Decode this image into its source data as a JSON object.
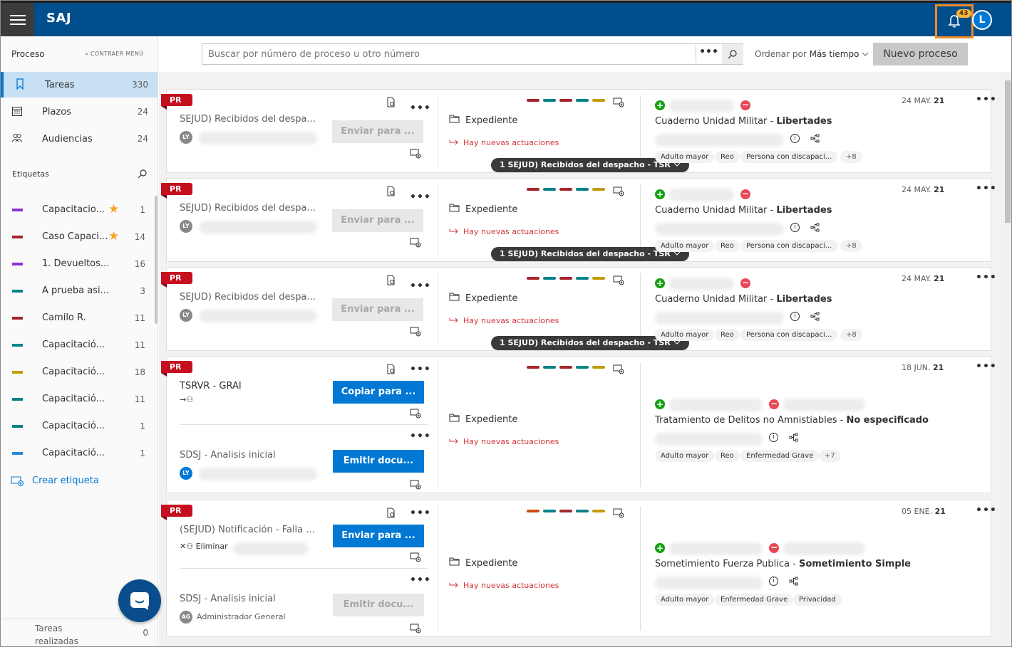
{
  "app": {
    "brand": "SAJ",
    "notifications": "43",
    "user_initial": "L"
  },
  "sidebar": {
    "header": "Proceso",
    "collapse": "« CONTRAER MENÚ",
    "nav": [
      {
        "label": "Tareas",
        "count": "330",
        "icon": "bookmark-icon"
      },
      {
        "label": "Plazos",
        "count": "24",
        "icon": "calendar-icon"
      },
      {
        "label": "Audiencias",
        "count": "24",
        "icon": "people-icon"
      }
    ],
    "tags_header": "Etiquetas",
    "tags": [
      {
        "label": "Capacitacio...",
        "count": "1",
        "color": "#8b30d6",
        "star": true
      },
      {
        "label": "Caso Capaci...",
        "count": "14",
        "color": "#a4262c",
        "star": true
      },
      {
        "label": "1. Devueltos...",
        "count": "16",
        "color": "#8b30d6",
        "star": false
      },
      {
        "label": "A prueba asi...",
        "count": "3",
        "color": "#038387",
        "star": false
      },
      {
        "label": "Camilo R.",
        "count": "11",
        "color": "#a4262c",
        "star": false
      },
      {
        "label": "Capacitació...",
        "count": "11",
        "color": "#038387",
        "star": false
      },
      {
        "label": "Capacitació...",
        "count": "18",
        "color": "#c19c00",
        "star": false
      },
      {
        "label": "Capacitació...",
        "count": "11",
        "color": "#038387",
        "star": false
      },
      {
        "label": "Capacitació...",
        "count": "1",
        "color": "#038387",
        "star": false
      },
      {
        "label": "Capacitació...",
        "count": "1",
        "color": "#2b88d8",
        "star": false
      }
    ],
    "create_tag": "Crear etiqueta",
    "done": {
      "label": "Tareas realizadas",
      "count": "0"
    }
  },
  "toolbar": {
    "search_placeholder": "Buscar por número de proceso u otro número",
    "more": "•••",
    "order_prefix": "Ordenar por ",
    "order_value": "Más tiempo",
    "new_button": "Nuevo proceso"
  },
  "cards": [
    {
      "badge": "PR",
      "tasks": [
        {
          "title": "SEJUD) Recibidos del despa...",
          "initials": "LY",
          "button": "Enviar para ...",
          "enabled": false
        }
      ],
      "expediente": "Expediente",
      "news": "Hay nuevas actuaciones",
      "pill": "1 SEJUD) Recibidos del despacho - TSR",
      "date_day": "24 MAY.",
      "date_year": "21",
      "case_title": "Cuaderno Unidad Militar - ",
      "case_sub": "Libertades",
      "chips": [
        "Adulto mayor",
        "Reo",
        "Persona con discapaci..."
      ],
      "chips_more": "+8"
    },
    {
      "badge": "PR",
      "tasks": [
        {
          "title": "SEJUD) Recibidos del despa...",
          "initials": "LY",
          "button": "Enviar para ...",
          "enabled": false
        }
      ],
      "expediente": "Expediente",
      "news": "Hay nuevas actuaciones",
      "pill": "1 SEJUD) Recibidos del despacho - TSR",
      "date_day": "24 MAY.",
      "date_year": "21",
      "case_title": "Cuaderno Unidad Militar - ",
      "case_sub": "Libertades",
      "chips": [
        "Adulto mayor",
        "Reo",
        "Persona con discapaci..."
      ],
      "chips_more": "+8"
    },
    {
      "badge": "PR",
      "tasks": [
        {
          "title": "SEJUD) Recibidos del despa...",
          "initials": "LY",
          "button": "Enviar para ...",
          "enabled": false
        }
      ],
      "expediente": "Expediente",
      "news": "Hay nuevas actuaciones",
      "pill": "1 SEJUD) Recibidos del despacho - TSR",
      "date_day": "24 MAY.",
      "date_year": "21",
      "case_title": "Cuaderno Unidad Militar - ",
      "case_sub": "Libertades",
      "chips": [
        "Adulto mayor",
        "Reo",
        "Persona con discapaci..."
      ],
      "chips_more": "+8"
    },
    {
      "badge": "PR",
      "tasks": [
        {
          "title": "TSRVR - GRAI",
          "button": "Copiar para ...",
          "enabled": true
        },
        {
          "title": "SDSJ - Analisis inicial",
          "initials": "LY",
          "button": "Emitir docu...",
          "enabled": true
        }
      ],
      "expediente": "Expediente",
      "news": "Hay nuevas actuaciones",
      "date_day": "18 JUN.",
      "date_year": "21",
      "case_title": "Tratamiento de Delitos no Amnistiables - ",
      "case_sub": "No especificado",
      "chips": [
        "Adulto mayor",
        "Reo",
        "Enfermedad Grave"
      ],
      "chips_more": "+7"
    },
    {
      "badge": "PR",
      "tasks": [
        {
          "title": "(SEJUD) Notificación - Falla ...",
          "sub": "Eliminar",
          "button": "Enviar para ...",
          "enabled": true
        },
        {
          "title": "SDSJ - Analisis inicial",
          "initials": "AG",
          "person": "Administrador General",
          "button": "Emitir docu...",
          "enabled": false
        }
      ],
      "expediente": "Expediente",
      "news": "Hay nuevas actuaciones",
      "date_day": "05 ENE.",
      "date_year": "21",
      "case_title": "Sometimiento Fuerza Publica - ",
      "case_sub": "Sometimiento Simple",
      "chips": [
        "Adulto mayor",
        "Enfermedad Grave",
        "Privacidad"
      ],
      "chips_more": ""
    }
  ],
  "colors": {
    "topbar": "#004e8c",
    "accent": "#0078d4",
    "badge_red": "#c50f1f",
    "news_red": "#d13438"
  }
}
